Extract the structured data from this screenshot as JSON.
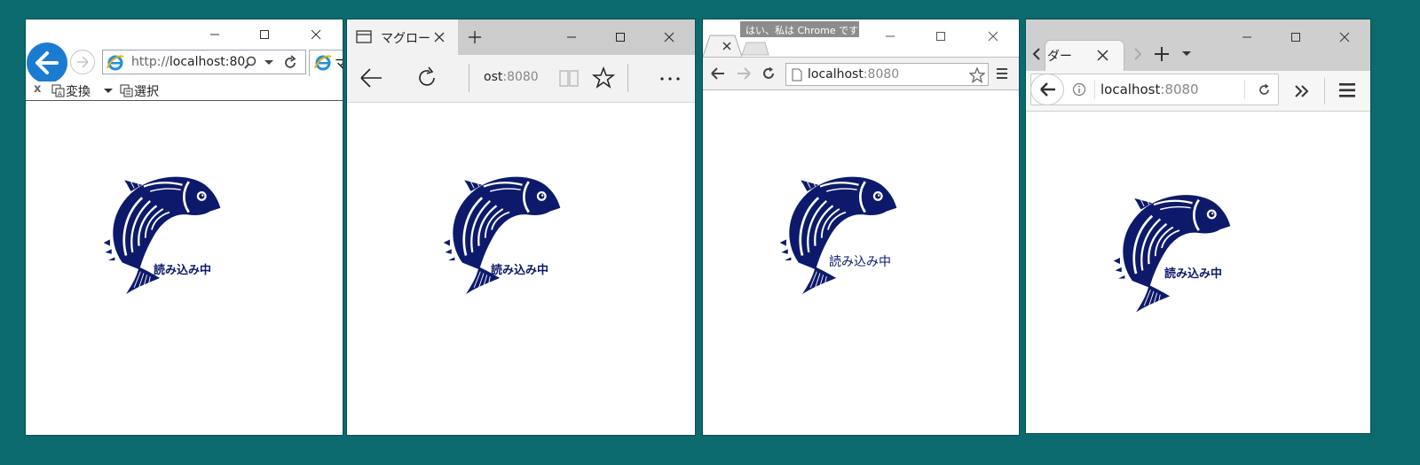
{
  "colors": {
    "desktop": "#0b6a6d",
    "fish_navy": "#0d1a6b",
    "ie_blue": "#1b7bd1"
  },
  "windows": [
    {
      "browser": "ie",
      "address_scheme": "http://",
      "address_host": "localhost:80",
      "tab_partial": "マ",
      "cmd_convert": "変換",
      "cmd_select": "選択",
      "cmd_close": "x",
      "loading_text": "読み込み中"
    },
    {
      "browser": "edge",
      "tab_title": "マグロー",
      "address_host_part": "ost",
      "address_port": ":8080",
      "loading_text": "読み込み中"
    },
    {
      "browser": "chrome",
      "profile_label": "はい、私は Chrome です",
      "address_host": "localhost",
      "address_port": ":8080",
      "loading_text": "読み込み中"
    },
    {
      "browser": "firefox",
      "tab_title": "ダー",
      "address_host": "localhost",
      "address_port": ":8080",
      "loading_text": "読み込み中"
    }
  ]
}
